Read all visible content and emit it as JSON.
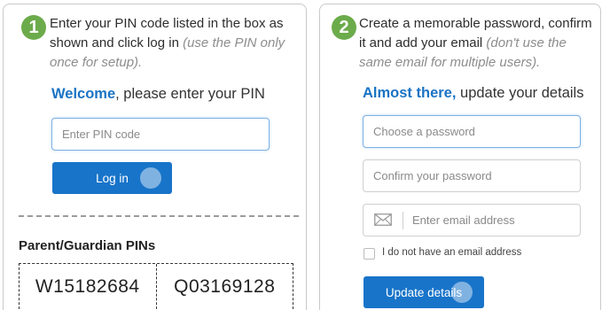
{
  "step1": {
    "number": "1",
    "instruction": "Enter your PIN code listed in the box as shown and click log in",
    "hint": "(use the PIN only once for setup).",
    "heading_accent": "Welcome",
    "heading_rest": ", please enter your PIN",
    "pin_input_placeholder": "Enter PIN code",
    "login_button": "Log in",
    "pins_title": "Parent/Guardian PINs",
    "pins": [
      "W15182684",
      "Q03169128"
    ]
  },
  "step2": {
    "number": "2",
    "instruction": "Create a memorable password, confirm it and add your email",
    "hint": "(don't use the same email for multiple users).",
    "heading_accent": "Almost there,",
    "heading_rest": " update your details",
    "password_placeholder": "Choose a password",
    "confirm_placeholder": "Confirm your password",
    "email_placeholder": "Enter email address",
    "no_email_label": "I do not have an email address",
    "update_button": "Update details"
  },
  "colors": {
    "accent_blue": "#1a73c4",
    "button_blue": "#1874c9",
    "step_green": "#6cab4b"
  },
  "icons": {
    "email_field_icon": "envelope-icon"
  }
}
